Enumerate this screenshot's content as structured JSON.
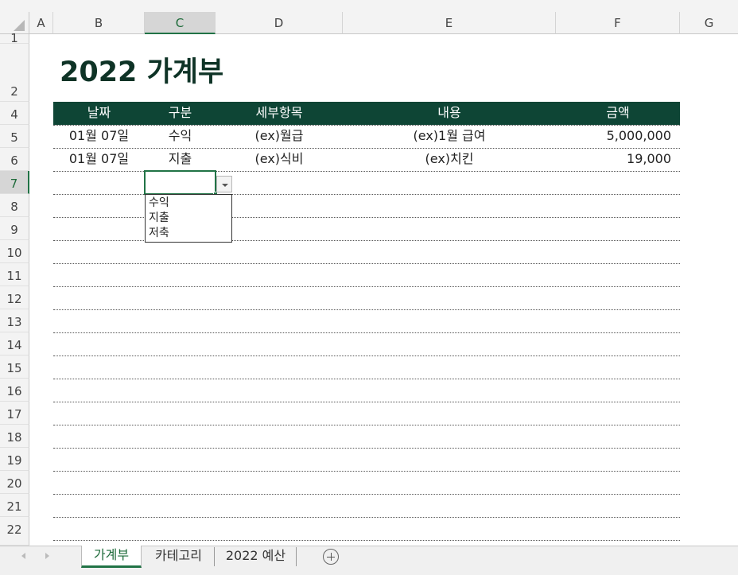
{
  "columns": [
    "A",
    "B",
    "C",
    "D",
    "E",
    "F",
    "G"
  ],
  "rows": [
    "1",
    "2",
    "4",
    "5",
    "6",
    "7",
    "8",
    "9",
    "10",
    "11",
    "12",
    "13",
    "14",
    "15",
    "16",
    "17",
    "18",
    "19",
    "20",
    "21",
    "22"
  ],
  "title": "2022 가계부",
  "table": {
    "headers": [
      "날짜",
      "구분",
      "세부항목",
      "내용",
      "금액"
    ],
    "rows": [
      {
        "date": "01월 07일",
        "type": "수익",
        "detail": "(ex)월급",
        "content": "(ex)1월 급여",
        "amount": "5,000,000"
      },
      {
        "date": "01월 07일",
        "type": "지출",
        "detail": "(ex)식비",
        "content": "(ex)치킨",
        "amount": "19,000"
      }
    ]
  },
  "dropdown": {
    "options": [
      "수익",
      "지출",
      "저축"
    ]
  },
  "sheet_tabs": [
    {
      "label": "가계부",
      "active": true
    },
    {
      "label": "카테고리",
      "active": false
    },
    {
      "label": "2022 예산",
      "active": false
    }
  ],
  "colors": {
    "header_fill": "#0e4535",
    "title": "#0e3326",
    "accent": "#217346"
  }
}
